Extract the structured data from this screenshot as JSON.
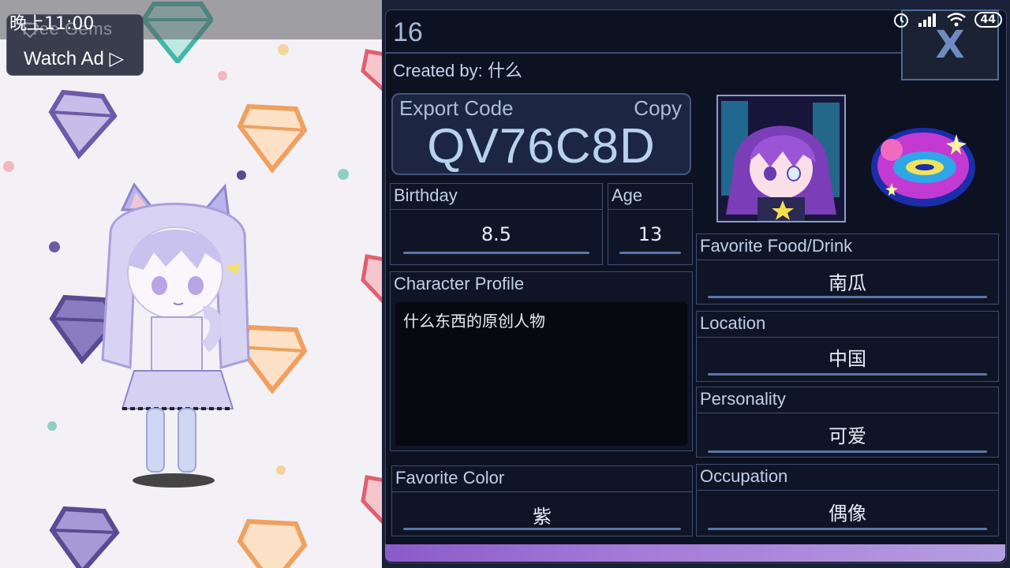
{
  "status_bar": {
    "time": "晚上11:00",
    "battery": "44",
    "icons": [
      "alarm-icon",
      "signal-icon",
      "wifi-icon",
      "battery-icon"
    ]
  },
  "ad_widget": {
    "free_gems_label": "Free Gems",
    "watch_ad_label": "Watch Ad ▷"
  },
  "profile": {
    "number": "16",
    "created_by_label": "Created by:",
    "created_by_value": "什么",
    "close_label": "X",
    "export_code_label": "Export Code",
    "copy_label": "Copy",
    "export_code": "QV76C8D",
    "birthday_label": "Birthday",
    "birthday_value": "8.5",
    "age_label": "Age",
    "age_value": "13",
    "character_profile_label": "Character Profile",
    "character_profile_text": "什么东西的原创人物",
    "favorite_color_label": "Favorite Color",
    "favorite_color_value": "紫",
    "favorite_food_label": "Favorite Food/Drink",
    "favorite_food_value": "南瓜",
    "location_label": "Location",
    "location_value": "中国",
    "personality_label": "Personality",
    "personality_value": "可爱",
    "occupation_label": "Occupation",
    "occupation_value": "偶像"
  },
  "colors": {
    "panel_bg": "#0d1222",
    "accent": "#5d76a6",
    "bottom_bar": "#8a5bc8"
  }
}
